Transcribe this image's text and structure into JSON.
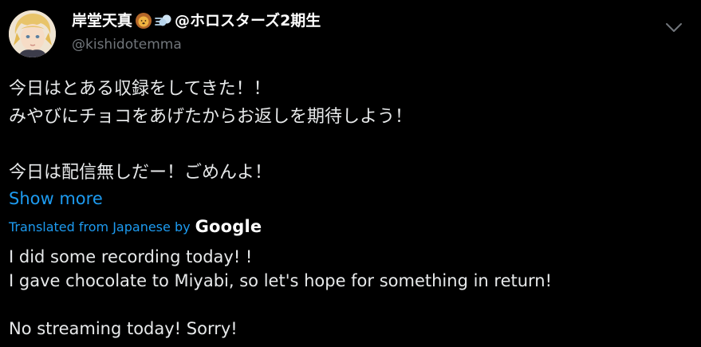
{
  "tweet": {
    "author": {
      "display_name": "岸堂天真",
      "display_name_suffix": "@ホロスターズ2期生",
      "handle": "@kishidotemma"
    },
    "icons": {
      "avatar": "avatar-image",
      "emoji_1": "lion-face-icon",
      "emoji_2": "dash-symbol-icon",
      "menu": "chevron-down-icon"
    },
    "body": "今日はとある収録をしてきた！！\nみやびにチョコをあげたからお返しを期待しよう！\n\n今日は配信無しだー！ごめんよ！",
    "show_more": "Show more",
    "translated_from": "Translated from Japanese by",
    "translator_brand": "Google",
    "translation": "I did some recording today! !\nI gave chocolate to Miyabi, so let's hope for something in return!\n\nNo streaming today! Sorry!"
  },
  "colors": {
    "background": "#000000",
    "text": "#e7e9ea",
    "muted": "#71767b",
    "link": "#1d9bf0"
  }
}
